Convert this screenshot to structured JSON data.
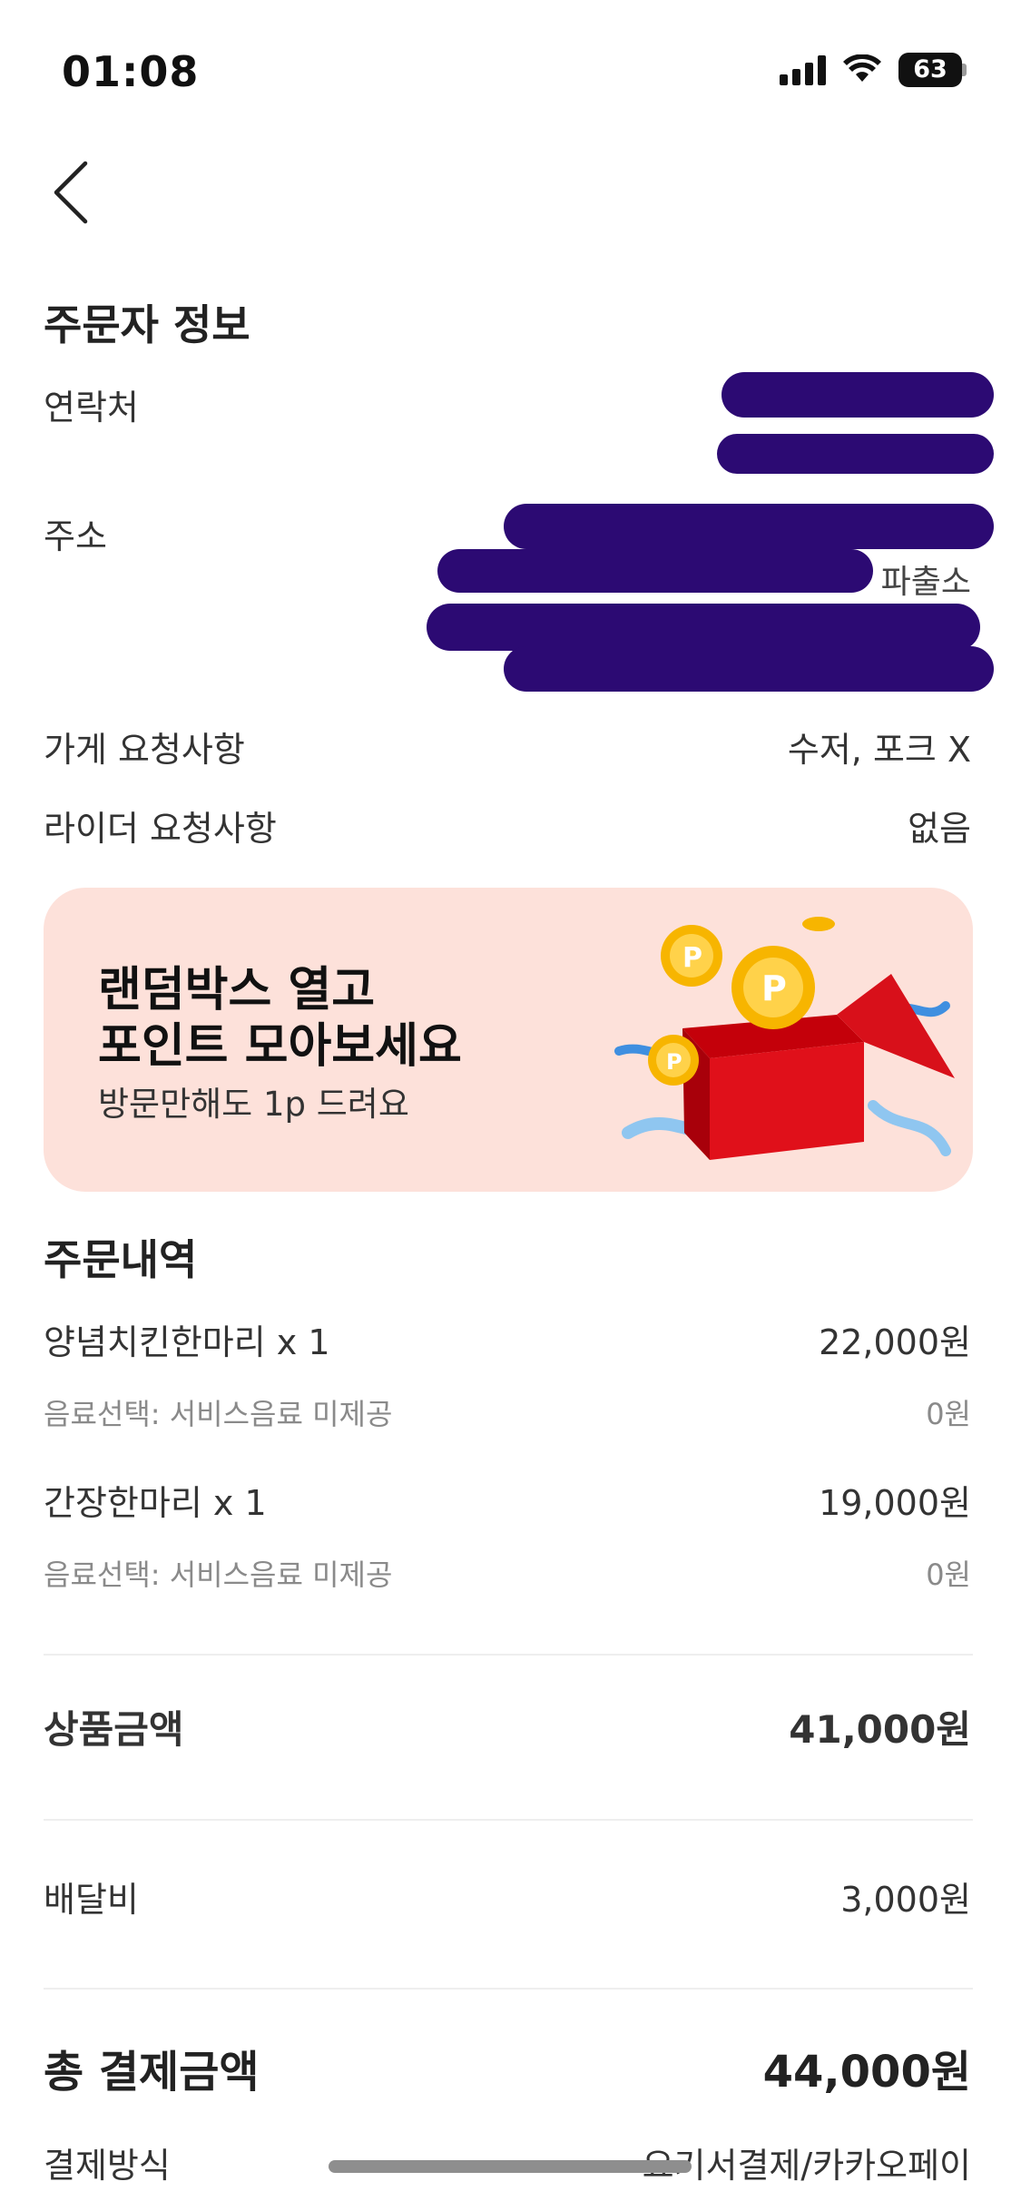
{
  "status_bar": {
    "time": "01:08",
    "battery": "63"
  },
  "orderer": {
    "title": "주문자 정보",
    "contact_label": "연락처",
    "address_label": "주소",
    "address_visible_fragment": "파출소",
    "store_request_label": "가게 요청사항",
    "store_request_value": "수저, 포크 X",
    "rider_request_label": "라이더 요청사항",
    "rider_request_value": "없음"
  },
  "banner": {
    "title_line1": "랜덤박스 열고",
    "title_line2": "포인트 모아보세요",
    "subtitle": "방문만해도 1p 드려요"
  },
  "order": {
    "title": "주문내역",
    "items": [
      {
        "name": "양념치킨한마리 x 1",
        "price": "22,000원",
        "option": "음료선택: 서비스음료 미제공",
        "option_price": "0원"
      },
      {
        "name": "간장한마리 x 1",
        "price": "19,000원",
        "option": "음료선택: 서비스음료 미제공",
        "option_price": "0원"
      }
    ]
  },
  "summary": {
    "subtotal_label": "상품금액",
    "subtotal_value": "41,000원",
    "delivery_label": "배달비",
    "delivery_value": "3,000원",
    "total_label": "총 결제금액",
    "total_value": "44,000원",
    "payment_label": "결제방식",
    "payment_value": "요기서결제/카카오페이"
  },
  "colors": {
    "banner_bg": "#fde1da",
    "redaction": "#2c0a73"
  }
}
